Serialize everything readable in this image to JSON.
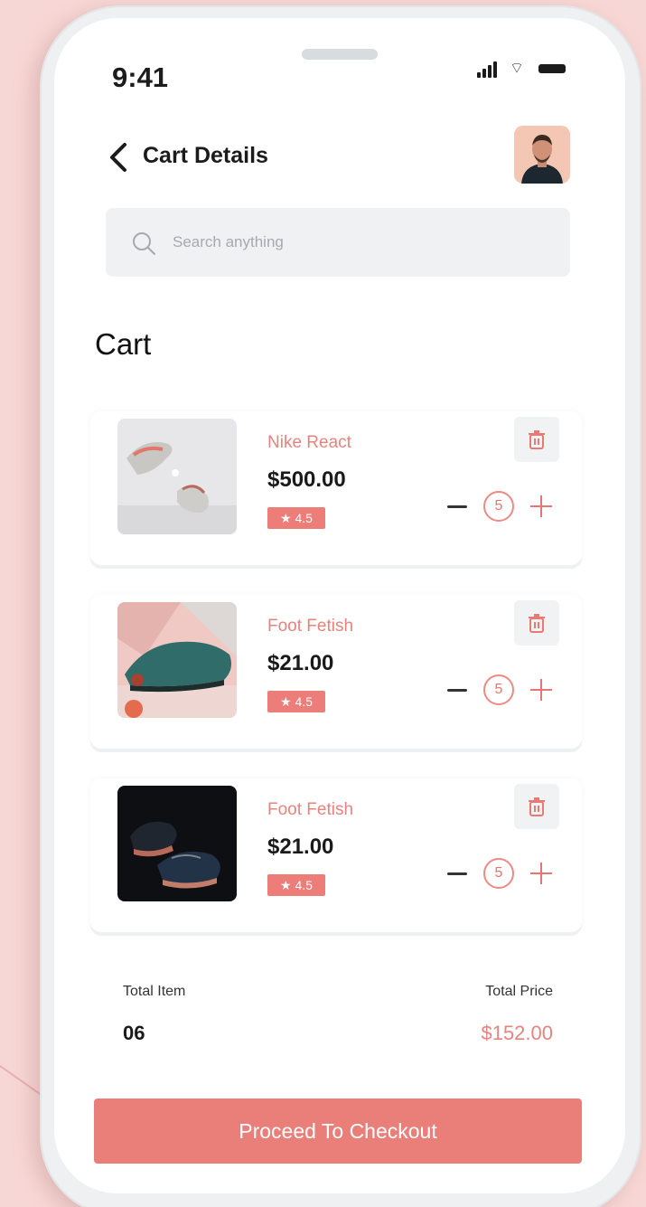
{
  "status_bar": {
    "time": "9:41"
  },
  "header": {
    "title": "Cart Details"
  },
  "search": {
    "placeholder": "Search anything"
  },
  "section": {
    "title": "Cart"
  },
  "cart_items": [
    {
      "name": "Nike React",
      "price": "$500.00",
      "rating": "★ 4.5",
      "quantity": "5"
    },
    {
      "name": "Foot Fetish",
      "price": "$21.00",
      "rating": "★ 4.5",
      "quantity": "5"
    },
    {
      "name": "Foot Fetish",
      "price": "$21.00",
      "rating": "★ 4.5",
      "quantity": "5"
    }
  ],
  "summary": {
    "total_item_label": "Total Item",
    "total_item_value": "06",
    "total_price_label": "Total Price",
    "total_price_value": "$152.00"
  },
  "checkout": {
    "label": "Proceed To Checkout"
  },
  "colors": {
    "accent": "#ea7f7a",
    "background": "#f7d7d5"
  }
}
